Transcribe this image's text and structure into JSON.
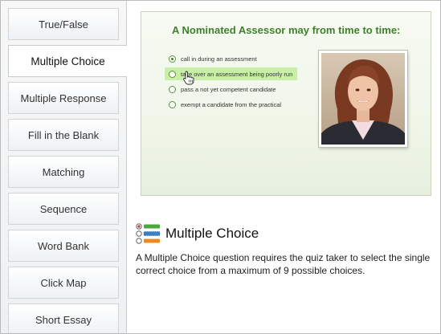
{
  "sidebar": {
    "tabs": [
      {
        "label": "True/False",
        "active": false
      },
      {
        "label": "Multiple Choice",
        "active": true
      },
      {
        "label": "Multiple Response",
        "active": false
      },
      {
        "label": "Fill in the Blank",
        "active": false
      },
      {
        "label": "Matching",
        "active": false
      },
      {
        "label": "Sequence",
        "active": false
      },
      {
        "label": "Word Bank",
        "active": false
      },
      {
        "label": "Click Map",
        "active": false
      },
      {
        "label": "Short Essay",
        "active": false
      }
    ]
  },
  "preview": {
    "question": "A Nominated Assessor may from time to time:",
    "options": [
      {
        "text": "call in during an assessment",
        "selected": true
      },
      {
        "text": "take over an assessment being poorly run",
        "highlighted": true
      },
      {
        "text": "pass a not yet competent candidate"
      },
      {
        "text": "exempt a candidate from the practical"
      }
    ],
    "accent": "#3f7f2c",
    "highlight": "#c9efa7"
  },
  "detail": {
    "title": "Multiple Choice",
    "description": "A Multiple Choice question requires the quiz taker to select the single correct choice from a maximum of 9 possible choices.",
    "icon": "multiple-choice-icon"
  }
}
